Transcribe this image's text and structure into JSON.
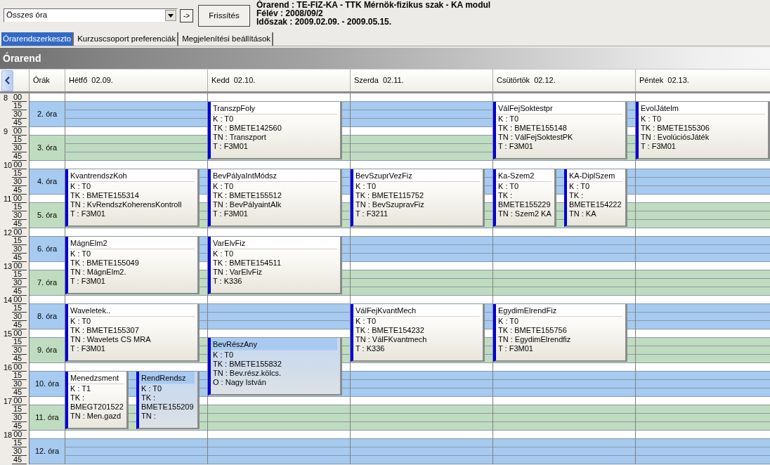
{
  "toolbar": {
    "view_dropdown": {
      "value": "Összes óra"
    },
    "go_button": "->",
    "refresh_button": "Frissítés"
  },
  "info_lines": [
    "Órarend : TE-FIZ-KA - TTK Mérnök-fizikus szak - KA modul",
    "Félév : 2008/09/2",
    "Időszak : 2009.02.09. - 2009.05.15."
  ],
  "tabs": [
    {
      "label": "Órarendszerkeszto",
      "selected": true
    },
    {
      "label": "Kurzuscsoport preferenciák",
      "selected": false
    },
    {
      "label": "Megjelenítési beállítások",
      "selected": false
    }
  ],
  "panel_title": "Órarend",
  "timetable": {
    "periods_header": "Órák",
    "time_axis": [
      {
        "hour": "8",
        "minutes": [
          "00",
          "15",
          "30",
          "45"
        ]
      },
      {
        "hour": "9",
        "minutes": [
          "00",
          "15",
          "30",
          "45"
        ]
      },
      {
        "hour": "10",
        "minutes": [
          "00",
          "15",
          "30",
          "45"
        ]
      },
      {
        "hour": "11",
        "minutes": [
          "00",
          "15",
          "30",
          "45"
        ]
      },
      {
        "hour": "12",
        "minutes": [
          "00",
          "15",
          "30",
          "45"
        ]
      },
      {
        "hour": "13",
        "minutes": [
          "00",
          "15",
          "30",
          "45"
        ]
      },
      {
        "hour": "14",
        "minutes": [
          "00",
          "15",
          "30",
          "45"
        ]
      },
      {
        "hour": "15",
        "minutes": [
          "00",
          "15",
          "30",
          "45"
        ]
      },
      {
        "hour": "16",
        "minutes": [
          "00",
          "15",
          "30",
          "45"
        ]
      },
      {
        "hour": "17",
        "minutes": [
          "00",
          "15",
          "30",
          "45"
        ]
      },
      {
        "hour": "18",
        "minutes": [
          "00",
          "15",
          "30",
          "45"
        ]
      }
    ],
    "periods": [
      {
        "label": "2. óra",
        "color": "#a6caf0"
      },
      {
        "label": "3. óra",
        "color": "#c0dcc0"
      },
      {
        "label": "4. óra",
        "color": "#a6caf0"
      },
      {
        "label": "5. óra",
        "color": "#c0dcc0"
      },
      {
        "label": "6. óra",
        "color": "#a6caf0"
      },
      {
        "label": "7. óra",
        "color": "#c0dcc0"
      },
      {
        "label": "8. óra",
        "color": "#a6caf0"
      },
      {
        "label": "9. óra",
        "color": "#c0dcc0"
      },
      {
        "label": "10. óra",
        "color": "#a6caf0"
      },
      {
        "label": "11. óra",
        "color": "#c0dcc0"
      },
      {
        "label": "12. óra",
        "color": "#a6caf0"
      }
    ],
    "days": [
      {
        "label": "Hétfő 02.09.",
        "blocks": [
          {
            "kind": "free"
          },
          {
            "kind": "free"
          },
          {
            "kind": "booked",
            "courses": [
              {
                "title": "KvantrendszKoh",
                "highlighted": false,
                "lines": [
                  "K : T0",
                  "TK : BMETE155314",
                  "TN : KvRendszKoherensKontroll",
                  "T : F3M01"
                ]
              }
            ]
          },
          {
            "kind": "booked",
            "courses": [
              {
                "title": "MágnElm2",
                "highlighted": false,
                "lines": [
                  "K : T0",
                  "TK : BMETE155049",
                  "TN : MágnElm2.",
                  "T : F3M01"
                ]
              }
            ]
          },
          {
            "kind": "booked",
            "courses": [
              {
                "title": "Waveletek..",
                "highlighted": false,
                "lines": [
                  "K : T0",
                  "TK : BMETE155307",
                  "TN : Wavelets CS MRA",
                  "T : F3M01"
                ]
              }
            ]
          },
          {
            "kind": "booked",
            "courses": [
              {
                "title": "Menedzsment",
                "highlighted": false,
                "lines": [
                  "K : T1",
                  "TK : BMEGT201522",
                  "TN : Men.gazd"
                ]
              },
              {
                "title": "RendRendsz",
                "highlighted": true,
                "lines": [
                  "K : T0",
                  "TK : BMETE155209",
                  "TN :"
                ]
              }
            ]
          },
          {
            "kind": "free"
          }
        ]
      },
      {
        "label": "Kedd 02.10.",
        "blocks": [
          {
            "kind": "booked",
            "courses": [
              {
                "title": "TranszpFoly",
                "highlighted": false,
                "lines": [
                  "K : T0",
                  "TK : BMETE142560",
                  "TN : Transzport",
                  "T : F3M01"
                ]
              }
            ]
          },
          {
            "kind": "booked",
            "courses": [
              {
                "title": "BevPályaIntMódsz",
                "highlighted": false,
                "lines": [
                  "K : T0",
                  "TK : BMETE155512",
                  "TN : BevPályaintAlk",
                  "T : F3M01"
                ]
              }
            ]
          },
          {
            "kind": "booked",
            "courses": [
              {
                "title": "VarElvFiz",
                "highlighted": false,
                "lines": [
                  "K : T0",
                  "TK : BMETE154511",
                  "TN : VarElvFiz",
                  "T : K336"
                ]
              }
            ]
          },
          {
            "kind": "free"
          },
          {
            "kind": "booked",
            "courses": [
              {
                "title": "BevRészAny",
                "highlighted": true,
                "lines": [
                  "K : T0",
                  "TK : BMETE155832",
                  "TN : Bev.rész.kölcs.",
                  "O : Nagy István"
                ]
              }
            ]
          },
          {
            "kind": "free"
          },
          {
            "kind": "free"
          }
        ]
      },
      {
        "label": "Szerda 02.11.",
        "blocks": [
          {
            "kind": "free"
          },
          {
            "kind": "free"
          },
          {
            "kind": "booked",
            "courses": [
              {
                "title": "BevSzuprVezFiz",
                "highlighted": false,
                "lines": [
                  "K : T0",
                  "TK : BMETE115752",
                  "TN : BevSzupravFiz",
                  "T : F3211"
                ]
              }
            ]
          },
          {
            "kind": "free"
          },
          {
            "kind": "free"
          },
          {
            "kind": "booked",
            "courses": [
              {
                "title": "VálFejKvantMech",
                "highlighted": false,
                "lines": [
                  "K : T0",
                  "TK : BMETE154232",
                  "TN : VálFKvantmech",
                  "T : K336"
                ]
              }
            ]
          },
          {
            "kind": "free"
          },
          {
            "kind": "free"
          },
          {
            "kind": "free"
          }
        ]
      },
      {
        "label": "Csütörtök 02.12.",
        "blocks": [
          {
            "kind": "booked",
            "courses": [
              {
                "title": "VálFejSoktestpr",
                "highlighted": false,
                "lines": [
                  "K : T0",
                  "TK : BMETE155148",
                  "TN : VálFejSoktestPK",
                  "T : F3M01"
                ]
              }
            ]
          },
          {
            "kind": "booked",
            "courses": [
              {
                "title": "Ka-Szem2",
                "highlighted": false,
                "lines": [
                  "K : T0",
                  "TK : BMETE155229",
                  "TN : Szem2 KA"
                ]
              },
              {
                "title": "KA-DiplSzem",
                "highlighted": false,
                "lines": [
                  "K : T0",
                  "TK : BMETE154222",
                  "TN : KA"
                ]
              }
            ]
          },
          {
            "kind": "free"
          },
          {
            "kind": "free"
          },
          {
            "kind": "booked",
            "courses": [
              {
                "title": "EgydimElrendFiz",
                "highlighted": false,
                "lines": [
                  "K : T0",
                  "TK : BMETE155756",
                  "TN : EgydimElrendfiz",
                  "T : F3M01"
                ]
              }
            ]
          },
          {
            "kind": "free"
          },
          {
            "kind": "free"
          },
          {
            "kind": "free"
          }
        ]
      },
      {
        "label": "Péntek 02.13.",
        "blocks": [
          {
            "kind": "booked",
            "courses": [
              {
                "title": "EvolJátelm",
                "highlighted": false,
                "lines": [
                  "K : T0",
                  "TK : BMETE155306",
                  "TN : EvolúciósJáték",
                  "T : F3M01"
                ]
              }
            ]
          },
          {
            "kind": "free"
          },
          {
            "kind": "free"
          },
          {
            "kind": "free"
          },
          {
            "kind": "free"
          },
          {
            "kind": "free"
          },
          {
            "kind": "free"
          },
          {
            "kind": "free"
          },
          {
            "kind": "free"
          },
          {
            "kind": "free"
          }
        ]
      }
    ]
  }
}
